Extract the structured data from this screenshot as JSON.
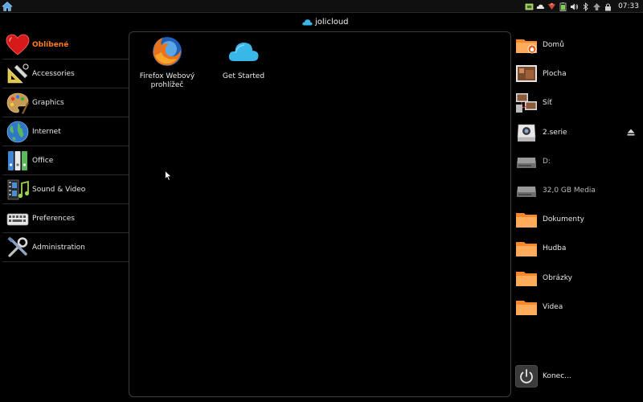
{
  "topbar": {
    "clock": "07:33",
    "tray_icons": [
      "network-icon",
      "cloud-icon",
      "wifi-icon",
      "battery-icon",
      "volume-icon",
      "bluetooth-icon",
      "update-icon",
      "lock-icon"
    ]
  },
  "brand": {
    "label": "jolicloud"
  },
  "categories": [
    {
      "label": "Oblíbené",
      "icon": "heart-icon"
    },
    {
      "label": "Accessories",
      "icon": "ruler-icon"
    },
    {
      "label": "Graphics",
      "icon": "palette-icon"
    },
    {
      "label": "Internet",
      "icon": "globe-icon"
    },
    {
      "label": "Office",
      "icon": "binders-icon"
    },
    {
      "label": "Sound & Video",
      "icon": "film-icon"
    },
    {
      "label": "Preferences",
      "icon": "keyboard-icon"
    },
    {
      "label": "Administration",
      "icon": "tools-icon"
    }
  ],
  "apps": [
    {
      "label_line1": "Firefox Webový",
      "label_line2": "prohlížeč",
      "icon": "firefox-icon"
    },
    {
      "label_line1": "Get Started",
      "label_line2": "",
      "icon": "cloud-icon"
    }
  ],
  "places": [
    {
      "label": "Domů",
      "icon": "home-folder-icon"
    },
    {
      "label": "Plocha",
      "icon": "desktop-icon"
    },
    {
      "label": "Síť",
      "icon": "network-computers-icon"
    },
    {
      "label": "2.serie",
      "icon": "camera-drive-icon"
    },
    {
      "label": "D:",
      "icon": "drive-icon"
    },
    {
      "label": "32,0 GB Media",
      "icon": "drive-icon"
    },
    {
      "label": "Dokumenty",
      "icon": "folder-icon"
    },
    {
      "label": "Hudba",
      "icon": "folder-icon"
    },
    {
      "label": "Obrázky",
      "icon": "folder-icon"
    },
    {
      "label": "Videa",
      "icon": "folder-icon"
    }
  ],
  "quit": {
    "label": "Konec..."
  },
  "colors": {
    "active_category": "#ff7b1c",
    "folder": "#f5892a",
    "cloud": "#39b7e8"
  }
}
